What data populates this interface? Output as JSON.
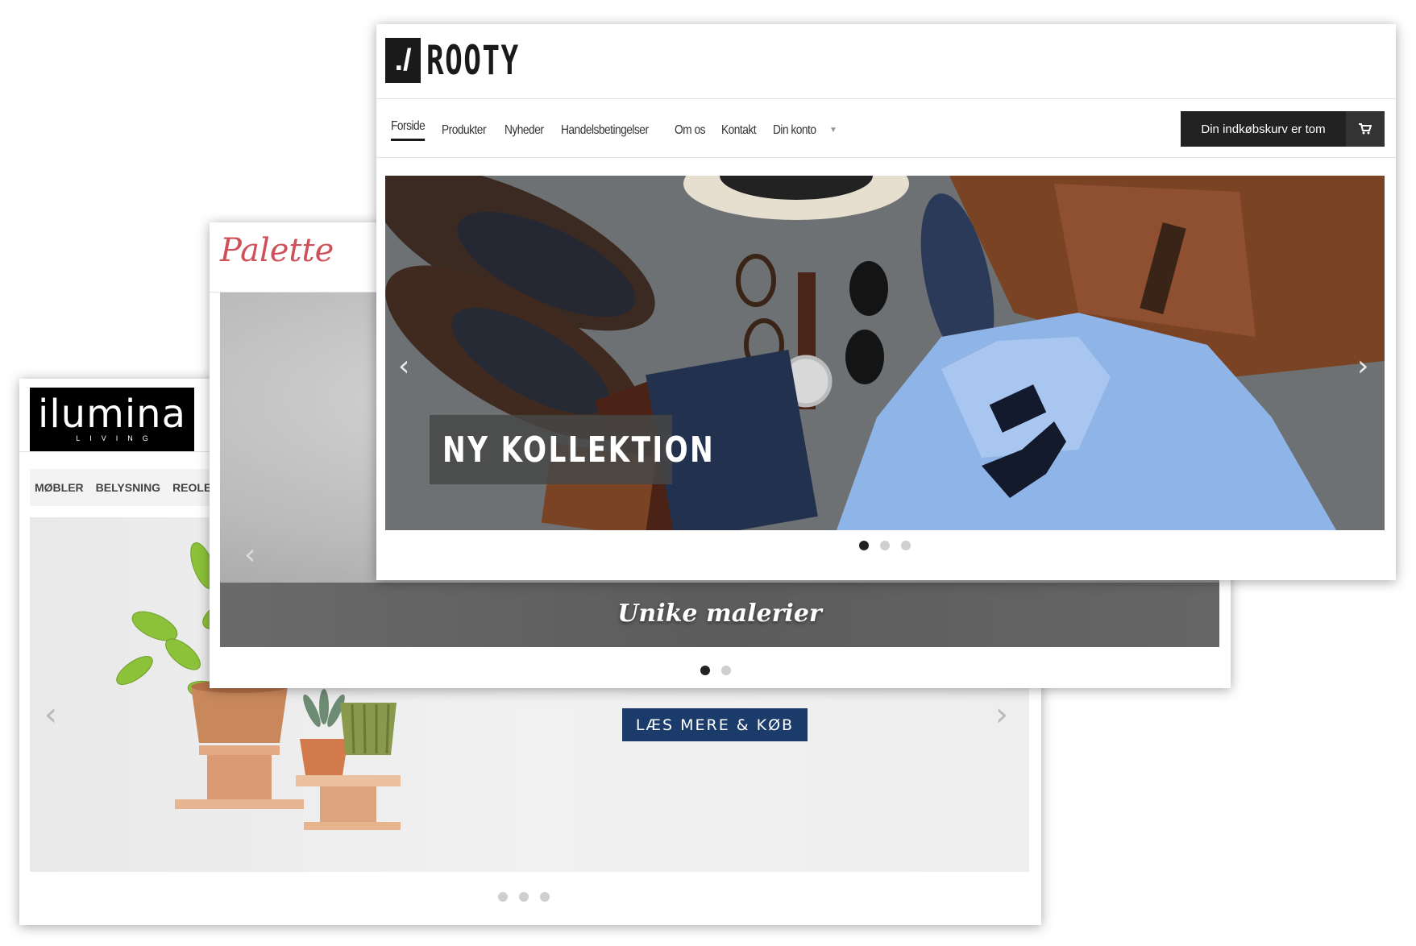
{
  "ilumina": {
    "logo": "ilumina",
    "logo_sub": "LIVING",
    "nav": [
      "MØBLER",
      "BELYSNING",
      "REOLER"
    ],
    "cta": "LÆS MERE & KØB",
    "dots": 3,
    "active_dot": 0
  },
  "palette": {
    "logo": "Palette",
    "caption": "Unike malerier",
    "dots": 2,
    "active_dot": 0
  },
  "rooty": {
    "logo_mark": "./",
    "logo": "ROOTY",
    "nav": [
      {
        "label": "Forside",
        "active": true
      },
      {
        "label": "Produkter"
      },
      {
        "label": "Nyheder"
      },
      {
        "label": "Handelsbetingelser"
      },
      {
        "label": "Om os"
      },
      {
        "label": "Kontakt"
      },
      {
        "label": "Din konto",
        "dropdown": true
      }
    ],
    "cart_label": "Din indkøbskurv er tom",
    "slide_caption": "NY KOLLEKTION",
    "dots": 3,
    "active_dot": 0
  },
  "icons": {
    "prev": "chevron-left-icon",
    "next": "chevron-right-icon",
    "cart": "shopping-cart-icon",
    "caret": "caret-down-icon"
  }
}
